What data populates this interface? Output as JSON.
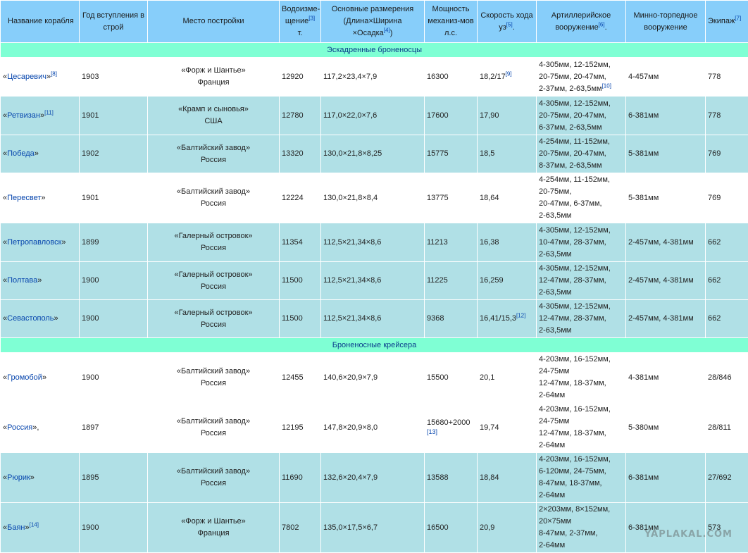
{
  "headers": {
    "name": "Название корабля",
    "year": "Год вступления в строй",
    "place": "Место постройки",
    "disp_a": "Водоизме-",
    "disp_b": "щение",
    "disp_ref": "[3]",
    "disp_c": " т.",
    "dims_a": "Основные размерения",
    "dims_b": "(Длина×Ширина",
    "dims_c": "×Осадка",
    "dims_ref": "[4]",
    "dims_d": ")",
    "power": "Мощность механиз-мов л.с.",
    "speed_a": "Скорость хода",
    "speed_b": "уз",
    "speed_ref": "[5]",
    "speed_c": ".",
    "art_a": "Артиллерийское вооружение",
    "art_ref": "[6]",
    "art_b": ".",
    "mine": "Минно-торпедное вооружение",
    "crew": "Экипаж",
    "crew_ref": "[7]"
  },
  "sections": {
    "battleships": "Эскадренные броненосцы",
    "cruisers": "Броненосные крейсера"
  },
  "rows": [
    {
      "name": "Цесаревич",
      "name_ref": "[8]",
      "year": "1903",
      "yard": "«Форж и Шантье»",
      "country": "Франция",
      "disp": "12920",
      "dims": "117,2×23,4×7,9",
      "power": "16300",
      "speed": "18,2/17",
      "speed_ref": "[9]",
      "art1": "4-305мм, 12-152мм,",
      "art2": "20-75мм, 20-47мм,",
      "art3": "2-37мм, 2-63,5мм",
      "art4": "",
      "art_ref": "[10]",
      "mine": "4-457мм",
      "crew": "778"
    },
    {
      "name": "Ретвизан",
      "name_ref": "[11]",
      "year": "1901",
      "yard": "«Крамп и сыновья»",
      "country": "США",
      "disp": "12780",
      "dims": "117,0×22,0×7,6",
      "power": "17600",
      "speed": "17,90",
      "art1": "4-305мм, 12-152мм,",
      "art2": "20-75мм, 20-47мм,",
      "art3": "6-37мм, 2-63,5мм",
      "art4": "",
      "mine": "6-381мм",
      "crew": "778"
    },
    {
      "name": "Победа",
      "year": "1902",
      "yard": "«Балтийский завод»",
      "country": "Россия",
      "disp": "13320",
      "dims": "130,0×21,8×8,25",
      "power": "15775",
      "speed": "18,5",
      "art1": "4-254мм, 11-152мм,",
      "art2": "20-75мм, 20-47мм,",
      "art3": "8-37мм, 2-63,5мм",
      "art4": "",
      "mine": "5-381мм",
      "crew": "769"
    },
    {
      "name": "Пересвет",
      "year": "1901",
      "yard": "«Балтийский завод»",
      "country": "Россия",
      "disp": "12224",
      "dims": "130,0×21,8×8,4",
      "power": "13775",
      "speed": "18,64",
      "art1": "4-254мм, 11-152мм,",
      "art2": "20-75мм,",
      "art3": "20-47мм, 6-37мм,",
      "art4": "2-63,5мм",
      "mine": "5-381мм",
      "crew": "769"
    },
    {
      "name": "Петропавловск",
      "year": "1899",
      "yard": "«Галерный островок»",
      "country": "Россия",
      "disp": "11354",
      "dims": "112,5×21,34×8,6",
      "power": "11213",
      "speed": "16,38",
      "art1": "4-305мм, 12-152мм,",
      "art2": "10-47мм, 28-37мм,",
      "art3": "2-63,5мм",
      "art4": "",
      "mine": "2-457мм, 4-381мм",
      "crew": "662"
    },
    {
      "name": "Полтава",
      "year": "1900",
      "yard": "«Галерный островок»",
      "country": "Россия",
      "disp": "11500",
      "dims": "112,5×21,34×8,6",
      "power": "11225",
      "speed": "16,259",
      "art1": "4-305мм, 12-152мм,",
      "art2": "12-47мм, 28-37мм,",
      "art3": "2-63,5мм",
      "art4": "",
      "mine": "2-457мм, 4-381мм",
      "crew": "662"
    },
    {
      "name": "Севастополь",
      "year": "1900",
      "yard": "«Галерный островок»",
      "country": "Россия",
      "disp": "11500",
      "dims": "112,5×21,34×8,6",
      "power": "9368",
      "speed": "16,41/15,3",
      "speed_ref": "[12]",
      "art1": "4-305мм, 12-152мм,",
      "art2": "12-47мм, 28-37мм,",
      "art3": "2-63,5мм",
      "art4": "",
      "mine": "2-457мм, 4-381мм",
      "crew": "662"
    },
    {
      "name": "Громобой",
      "year": "1900",
      "yard": "«Балтийский завод»",
      "country": "Россия",
      "disp": "12455",
      "dims": "140,6×20,9×7,9",
      "power": "15500",
      "speed": "20,1",
      "art1": "4-203мм, 16-152мм,",
      "art2": "24-75мм",
      "art3": "12-47мм, 18-37мм,",
      "art4": "2-64мм",
      "mine": "4-381мм",
      "crew": "28/846"
    },
    {
      "name": "Россия",
      "name_after": ",",
      "year": "1897",
      "yard": "«Балтийский завод»",
      "country": "Россия",
      "disp": "12195",
      "dims": "147,8×20,9×8,0",
      "power": "15680+2000",
      "power_ref": "[13]",
      "speed": "19,74",
      "art1": "4-203мм, 16-152мм,",
      "art2": "24-75мм",
      "art3": "12-47мм, 18-37мм,",
      "art4": "2-64мм",
      "mine": "5-380мм",
      "crew": "28/811"
    },
    {
      "name": "Рюрик",
      "year": "1895",
      "yard": "«Балтийский завод»",
      "country": "Россия",
      "disp": "11690",
      "dims": "132,6×20,4×7,9",
      "power": "13588",
      "speed": "18,84",
      "art1": "4-203мм, 16-152мм,",
      "art2": "6-120мм, 24-75мм,",
      "art3": "8-47мм, 18-37мм,",
      "art4": "2-64мм",
      "mine": "6-381мм",
      "crew": "27/692"
    },
    {
      "name": "Баян",
      "name_ref": "[14]",
      "year": "1900",
      "yard": "«Форж и Шантье»",
      "country": "Франция",
      "disp": "7802",
      "dims": "135,0×17,5×6,7",
      "power": "16500",
      "speed": "20,9",
      "art1": "2×203мм, 8×152мм,",
      "art2": "20×75мм",
      "art3": "8-47мм, 2-37мм,",
      "art4": "2-64мм",
      "mine": "6-381мм",
      "crew": "573"
    }
  ],
  "quote_open": "«",
  "quote_close": "»",
  "watermark": "YAPLAKAL.COM"
}
